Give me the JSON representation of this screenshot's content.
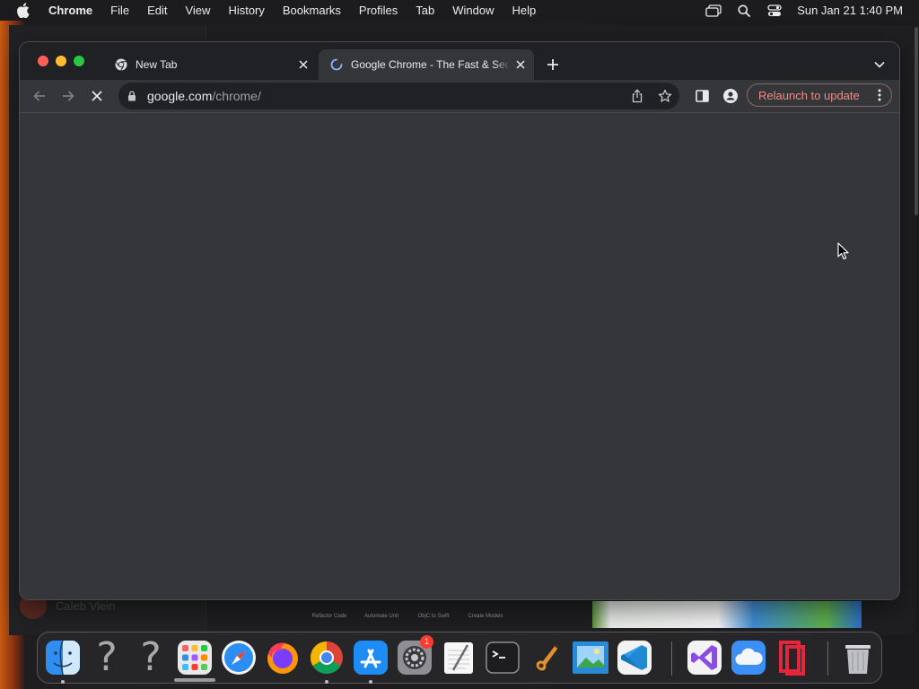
{
  "menubar": {
    "app_name": "Chrome",
    "items": [
      {
        "label": "File"
      },
      {
        "label": "Edit"
      },
      {
        "label": "View"
      },
      {
        "label": "History"
      },
      {
        "label": "Bookmarks"
      },
      {
        "label": "Profiles"
      },
      {
        "label": "Tab"
      },
      {
        "label": "Window"
      },
      {
        "label": "Help"
      }
    ],
    "status_icons": [
      "screen-mirroring-icon",
      "spotlight-search-icon",
      "control-center-icon"
    ],
    "clock": "Sun Jan 21  1:40 PM"
  },
  "background": {
    "user_name": "Caleb Vlein",
    "thumbnails": [
      "Refactor Code",
      "Automate Unit",
      "ObjC to Swift",
      "Create Models"
    ]
  },
  "browser": {
    "tabs": [
      {
        "title": "New Tab",
        "favicon": "chrome-logo-icon",
        "active": false
      },
      {
        "title": "Google Chrome - The Fast & Secure",
        "favicon": "loading-spinner-icon",
        "active": true
      }
    ],
    "address": {
      "host": "google.com",
      "path": "/chrome/"
    },
    "relaunch_label": "Relaunch to update",
    "page_loading": true
  },
  "dock": {
    "apps": [
      {
        "name": "Finder",
        "icon": "finder-icon",
        "running": true
      },
      {
        "name": "Unknown",
        "icon": "question-mark-icon",
        "running": false
      },
      {
        "name": "Unknown",
        "icon": "question-mark-icon",
        "running": false
      },
      {
        "name": "Launchpad",
        "icon": "launchpad-icon",
        "running": false
      },
      {
        "name": "Safari",
        "icon": "safari-icon",
        "running": false
      },
      {
        "name": "Firefox",
        "icon": "firefox-icon",
        "running": false
      },
      {
        "name": "Google Chrome",
        "icon": "chrome-icon",
        "running": true
      },
      {
        "name": "App Store",
        "icon": "app-store-icon",
        "running": true
      },
      {
        "name": "System Settings",
        "icon": "system-settings-icon",
        "running": false,
        "badge": "1"
      },
      {
        "name": "TextEdit",
        "icon": "textedit-icon",
        "running": false
      },
      {
        "name": "Terminal",
        "icon": "terminal-icon",
        "running": false
      },
      {
        "name": "GarageBand",
        "icon": "garageband-icon",
        "running": false
      },
      {
        "name": "Preview",
        "icon": "preview-icon",
        "running": false
      },
      {
        "name": "Visual Studio Code",
        "icon": "vscode-icon",
        "running": false
      },
      {
        "name": "Visual Studio",
        "icon": "visual-studio-icon",
        "running": false
      },
      {
        "name": "Weather",
        "icon": "weather-icon",
        "running": false
      },
      {
        "name": "Parallels",
        "icon": "parallels-icon",
        "running": false
      },
      {
        "name": "Trash",
        "icon": "trash-icon",
        "running": false
      }
    ]
  }
}
